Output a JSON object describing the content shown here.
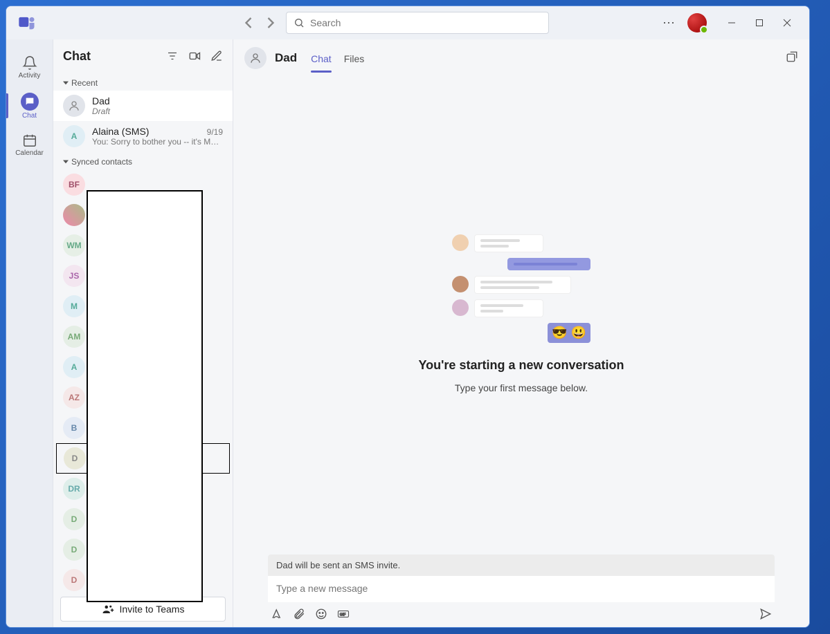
{
  "titlebar": {
    "search_placeholder": "Search"
  },
  "rail": {
    "activity": "Activity",
    "chat": "Chat",
    "calendar": "Calendar"
  },
  "leftpanel": {
    "title": "Chat",
    "section_recent": "Recent",
    "section_synced": "Synced contacts",
    "invite": "Invite to Teams"
  },
  "recent": [
    {
      "name": "Dad",
      "sub": "Draft",
      "time": "",
      "active": true,
      "avatar_type": "person"
    },
    {
      "name": "Alaina (SMS)",
      "sub": "You: Sorry to bother you -- it's Mar…",
      "time": "9/19",
      "active": false,
      "avatar_type": "letter",
      "initials": "A",
      "color": "c-ltb"
    }
  ],
  "contacts": [
    {
      "initials": "BF",
      "color": "c-pink"
    },
    {
      "initials": "",
      "color": "c-photo"
    },
    {
      "initials": "WM",
      "color": "c-ltg"
    },
    {
      "initials": "JS",
      "color": "c-lp"
    },
    {
      "initials": "M",
      "color": "c-ltb"
    },
    {
      "initials": "AM",
      "color": "c-lg"
    },
    {
      "initials": "A",
      "color": "c-ltb"
    },
    {
      "initials": "AZ",
      "color": "c-ltp"
    },
    {
      "initials": "B",
      "color": "c-bb"
    },
    {
      "initials": "D",
      "color": "c-olive",
      "selected": true
    },
    {
      "initials": "DR",
      "color": "c-mint"
    },
    {
      "initials": "D",
      "color": "c-lg"
    },
    {
      "initials": "D",
      "color": "c-lg"
    },
    {
      "initials": "D",
      "color": "c-ltp"
    }
  ],
  "conversation": {
    "title": "Dad",
    "tabs": {
      "chat": "Chat",
      "files": "Files"
    },
    "empty_heading": "You're starting a new conversation",
    "empty_sub": "Type your first message below.",
    "sms_note": "Dad will be sent an SMS invite.",
    "compose_placeholder": "Type a new message"
  }
}
